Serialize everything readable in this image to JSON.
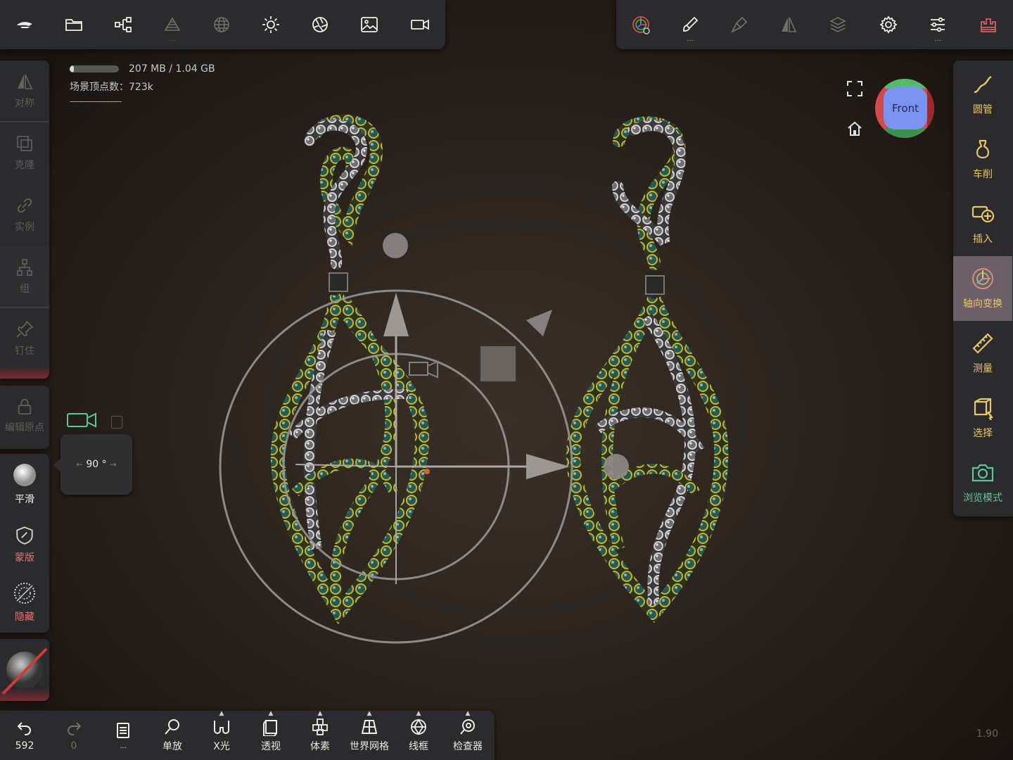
{
  "top_toolbar_left": [
    {
      "name": "app-logo-icon"
    },
    {
      "name": "folder-icon"
    },
    {
      "name": "scene-graph-icon"
    },
    {
      "name": "layers-stack-icon"
    },
    {
      "name": "sphere-mesh-icon"
    },
    {
      "name": "light-sun-icon"
    },
    {
      "name": "aperture-icon"
    },
    {
      "name": "image-icon"
    },
    {
      "name": "video-camera-icon"
    }
  ],
  "top_toolbar_right": [
    {
      "name": "gizmo-icon"
    },
    {
      "name": "brush-icon",
      "dots": "..."
    },
    {
      "name": "paint-tool-icon"
    },
    {
      "name": "symmetry-mirror-icon"
    },
    {
      "name": "layers-icon"
    },
    {
      "name": "settings-gear-icon"
    },
    {
      "name": "sliders-icon",
      "dots": "..."
    },
    {
      "name": "castle-icon"
    }
  ],
  "memory": {
    "usage": "207 MB / 1.04 GB",
    "fill": 0.08
  },
  "scene_vertex_label": "场景顶点数：723k",
  "scene_divider": "----------------------",
  "left_tools": {
    "symmetry": "对称",
    "clone": "克隆",
    "instance": "实例",
    "group": "组",
    "pin": "钉住",
    "edit_origin": "编辑原点",
    "smooth": "平滑",
    "mask": "蒙版",
    "hide": "隐藏"
  },
  "angle_popup": {
    "value": "90 °"
  },
  "view_cube": {
    "label": "Front"
  },
  "right_tools": [
    {
      "label": "圆管",
      "icon": "tube-curve-icon"
    },
    {
      "label": "车削",
      "icon": "lathe-vase-icon"
    },
    {
      "label": "插入",
      "icon": "insert-plus-icon"
    },
    {
      "label": "轴向变换",
      "icon": "axis-transform-icon",
      "active": true
    },
    {
      "label": "测量",
      "icon": "ruler-icon"
    },
    {
      "label": "选择",
      "icon": "select-cube-icon"
    },
    {
      "label": "浏览模式",
      "icon": "camera-icon"
    }
  ],
  "bottom_toolbar": {
    "undo_count": "592",
    "redo_count": "0",
    "menu_dots": "...",
    "items": [
      {
        "label": "单放",
        "icon": "search-icon"
      },
      {
        "label": "X光",
        "icon": "xray-glasses-icon"
      },
      {
        "label": "透视",
        "icon": "perspective-icon"
      },
      {
        "label": "体素",
        "icon": "voxel-icon"
      },
      {
        "label": "世界网格",
        "icon": "world-grid-icon"
      },
      {
        "label": "线框",
        "icon": "wireframe-icon"
      },
      {
        "label": "检查器",
        "icon": "inspector-icon"
      }
    ]
  },
  "version": "1.90",
  "colors": {
    "accent_gold": "#e9c66a",
    "active_bg": "#6b5f68",
    "panel": "#2b2b2d",
    "cube_front": "#7a93f0"
  }
}
